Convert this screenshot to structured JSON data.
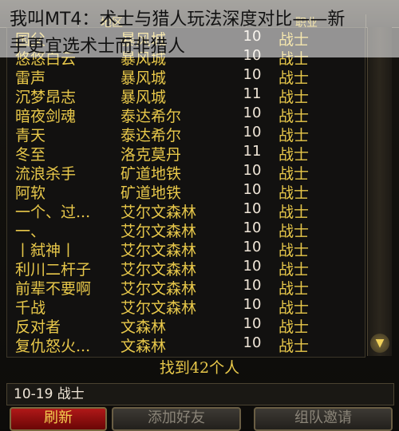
{
  "overlay": {
    "line1": "我叫MT4：术士与猎人玩法深度对比——新",
    "line2": "手更宜选术士而非猎人"
  },
  "header": {
    "columns": [
      "",
      "地区",
      "",
      "职业"
    ]
  },
  "rows": [
    {
      "name": "国父",
      "zone": "暴风城",
      "level": "10",
      "class": "战士"
    },
    {
      "name": "悠悠白云",
      "zone": "暴风城",
      "level": "10",
      "class": "战士"
    },
    {
      "name": "雷声",
      "zone": "暴风城",
      "level": "10",
      "class": "战士"
    },
    {
      "name": "沉梦昂志",
      "zone": "暴风城",
      "level": "11",
      "class": "战士"
    },
    {
      "name": "暗夜剑魂",
      "zone": "泰达希尔",
      "level": "10",
      "class": "战士"
    },
    {
      "name": "青天",
      "zone": "泰达希尔",
      "level": "10",
      "class": "战士"
    },
    {
      "name": "冬至",
      "zone": "洛克莫丹",
      "level": "11",
      "class": "战士"
    },
    {
      "name": "流浪杀手",
      "zone": "矿道地铁",
      "level": "10",
      "class": "战士"
    },
    {
      "name": "阿软",
      "zone": "矿道地铁",
      "level": "10",
      "class": "战士"
    },
    {
      "name": "一个、过...",
      "zone": "艾尔文森林",
      "level": "10",
      "class": "战士"
    },
    {
      "name": "一、",
      "zone": "艾尔文森林",
      "level": "10",
      "class": "战士"
    },
    {
      "name": "丨弑神丨",
      "zone": "艾尔文森林",
      "level": "10",
      "class": "战士"
    },
    {
      "name": "利川二杆子",
      "zone": "艾尔文森林",
      "level": "10",
      "class": "战士"
    },
    {
      "name": "前辈不要啊",
      "zone": "艾尔文森林",
      "level": "10",
      "class": "战士"
    },
    {
      "name": "千战",
      "zone": "艾尔文森林",
      "level": "10",
      "class": "战士"
    },
    {
      "name": "反对者",
      "zone": "文森林",
      "level": "10",
      "class": "战士"
    },
    {
      "name": "复仇怒火...",
      "zone": "文森林",
      "level": "10",
      "class": "战士"
    }
  ],
  "found_text": "找到42个人",
  "query_text": "10-19 战士",
  "buttons": {
    "refresh": "刷新",
    "add_friend": "添加好友",
    "group_invite": "组队邀请"
  },
  "icons": {
    "scroll_down": "scroll-down-icon"
  },
  "colors": {
    "gold_text": "#e8c84a",
    "primary_button": "#b01818"
  }
}
